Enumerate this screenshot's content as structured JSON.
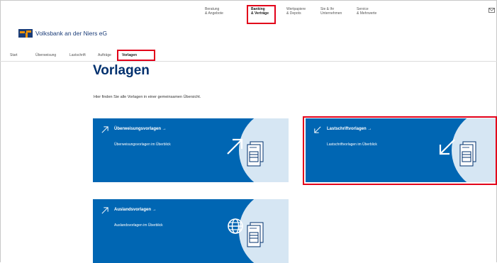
{
  "topnav": {
    "items": [
      {
        "line1": "Beratung",
        "line2": "& Angebote"
      },
      {
        "line1": "Banking",
        "line2": "& Verträge"
      },
      {
        "line1": "Wertpapiere",
        "line2": "& Depots"
      },
      {
        "line1": "Sie & Ihr",
        "line2": "Unternehmen"
      },
      {
        "line1": "Service",
        "line2": "& Mehrwerte"
      }
    ],
    "active_index": 1,
    "mail_icon": "mail-icon"
  },
  "brand": {
    "name": "Volksbank an der Niers eG",
    "logo_icon": "vr-logo",
    "colors": {
      "primary": "#0066b3",
      "dark": "#00306e",
      "orange": "#f39200",
      "highlight": "#e2001a"
    }
  },
  "subnav": {
    "items": [
      "Start",
      "Überweisung",
      "Lastschrift",
      "Aufträge",
      "Vorlagen"
    ],
    "active_index": 4
  },
  "page": {
    "title": "Vorlagen",
    "intro": "Hier finden Sie alle Vorlagen in einer gemeinsamen Übersicht."
  },
  "tiles": [
    {
      "title": "Überweisungsvorlagen",
      "subtitle": "Überweisungsvorlagen im Überblick",
      "icon": "arrow-up-right-icon",
      "highlighted": false
    },
    {
      "title": "Lastschriftvorlagen",
      "subtitle": "Lastschriftvorlagen im Überblick",
      "icon": "arrow-down-left-icon",
      "highlighted": true
    },
    {
      "title": "Auslandsvorlagen",
      "subtitle": "Auslandsvorlagen im Überblick",
      "icon": "globe-icon",
      "highlighted": false
    }
  ]
}
